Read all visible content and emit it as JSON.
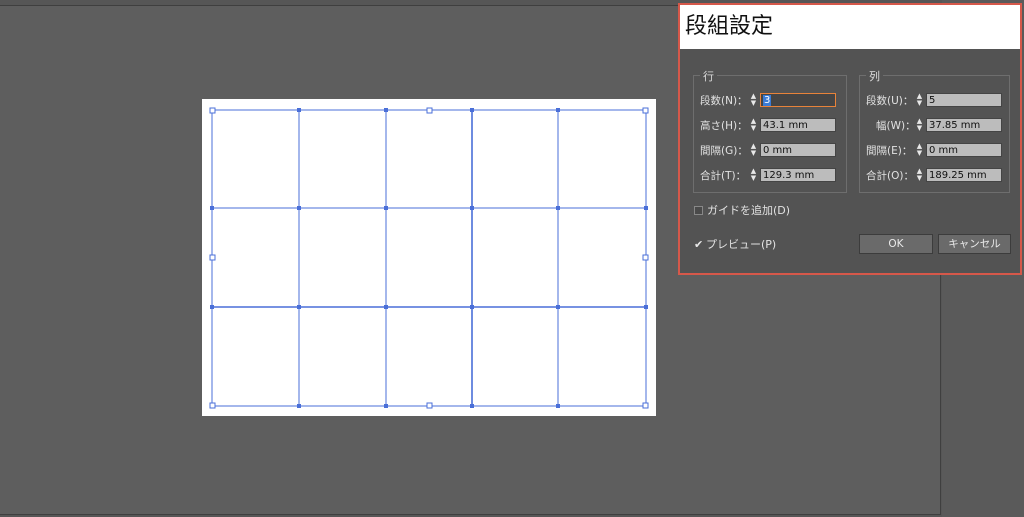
{
  "dialog": {
    "title": "段組設定",
    "rows_group": {
      "title": "行",
      "fields": [
        {
          "label": "段数(N)：",
          "value": "3"
        },
        {
          "label": "高さ(H)：",
          "value": "43.1 mm"
        },
        {
          "label": "間隔(G)：",
          "value": "0 mm"
        },
        {
          "label": "合計(T)：",
          "value": "129.3 mm"
        }
      ]
    },
    "cols_group": {
      "title": "列",
      "fields": [
        {
          "label": "段数(U)：",
          "value": "5"
        },
        {
          "label": "幅(W)：",
          "value": "37.85 mm"
        },
        {
          "label": "間隔(E)：",
          "value": "0 mm"
        },
        {
          "label": "合計(O)：",
          "value": "189.25 mm"
        }
      ]
    },
    "add_guides_label": "ガイドを追加(D)",
    "add_guides_checked": false,
    "preview_label": "プレビュー(P)",
    "preview_checked": true,
    "ok_label": "OK",
    "cancel_label": "キャンセル"
  },
  "colors": {
    "guide": "#4a6fd8",
    "dialog_border": "#d6584a",
    "focus_border": "#e8833a"
  }
}
